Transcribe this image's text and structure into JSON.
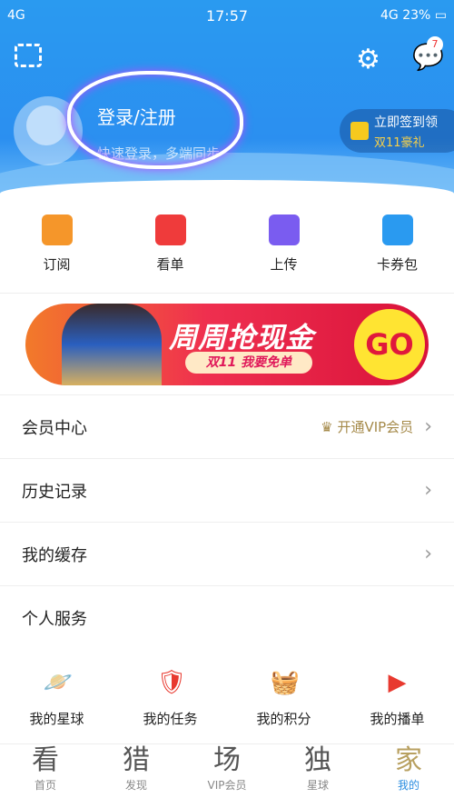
{
  "status": {
    "carrier": "4G",
    "time": "17:57",
    "network": "4G",
    "battery": "23%"
  },
  "header": {
    "message_badge": "7",
    "login": "登录/注册",
    "subtitle": "快速登录，多端同步",
    "signin_line1": "立即签到领",
    "signin_line2": "双11豪礼"
  },
  "quick": [
    {
      "label": "订阅",
      "icon": "subscribe-icon",
      "color": "#f5962a"
    },
    {
      "label": "看单",
      "icon": "heart-icon",
      "color": "#ef3b3b"
    },
    {
      "label": "上传",
      "icon": "upload-icon",
      "color": "#7a5cf0"
    },
    {
      "label": "卡券包",
      "icon": "ticket-icon",
      "color": "#2a9af0"
    }
  ],
  "banner": {
    "title": "周周抢现金",
    "subtitle": "双11 我要免单",
    "go": "GO"
  },
  "rows": [
    {
      "label": "会员中心",
      "right": "开通VIP会员"
    },
    {
      "label": "历史记录"
    },
    {
      "label": "我的缓存"
    },
    {
      "label": "个人服务"
    }
  ],
  "services": [
    {
      "label": "我的星球",
      "icon": "planet-icon"
    },
    {
      "label": "我的任务",
      "icon": "task-icon"
    },
    {
      "label": "我的积分",
      "icon": "basket-icon"
    },
    {
      "label": "我的播单",
      "icon": "playlist-icon"
    }
  ],
  "nav": [
    {
      "glyph": "看",
      "label": "首页"
    },
    {
      "glyph": "猎",
      "label": "发现"
    },
    {
      "glyph": "场",
      "label": "VIP会员"
    },
    {
      "glyph": "独",
      "label": "星球"
    },
    {
      "glyph": "家",
      "label": "我的",
      "active": true
    }
  ]
}
